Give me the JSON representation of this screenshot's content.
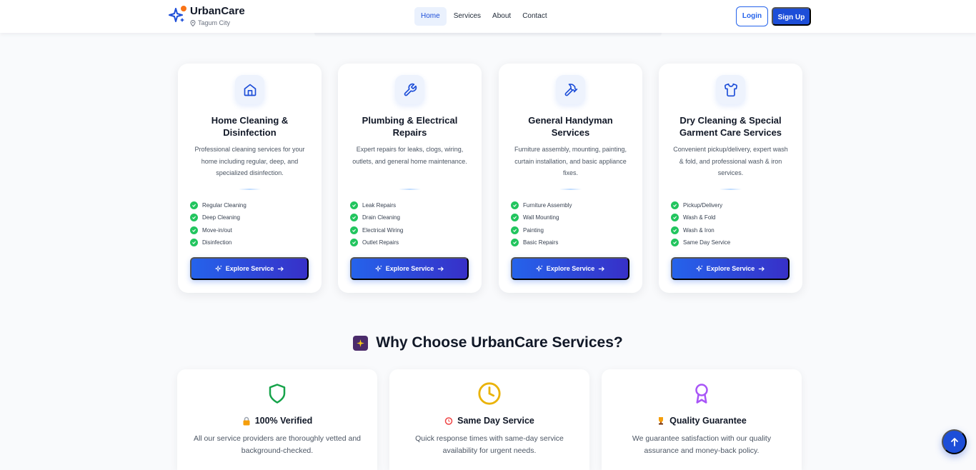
{
  "navbar": {
    "brand": "UrbanCare",
    "location": "Tagum City",
    "links": [
      "Home",
      "Services",
      "About",
      "Contact"
    ],
    "active_link": "Home",
    "login_label": "Login",
    "signup_label": "Sign Up"
  },
  "services": [
    {
      "icon": "home-icon",
      "title": "Home Cleaning & Disinfection",
      "description": "Professional cleaning services for your home including regular, deep, and specialized disinfection.",
      "features": [
        "Regular Cleaning",
        "Deep Cleaning",
        "Move-in/out",
        "Disinfection"
      ],
      "button": "Explore Service"
    },
    {
      "icon": "wrench-icon",
      "title": "Plumbing & Electrical Repairs",
      "description": "Expert repairs for leaks, clogs, wiring, outlets, and general home maintenance.",
      "features": [
        "Leak Repairs",
        "Drain Cleaning",
        "Electrical Wiring",
        "Outlet Repairs"
      ],
      "button": "Explore Service"
    },
    {
      "icon": "hammer-icon",
      "title": "General Handyman Services",
      "description": "Furniture assembly, mounting, painting, curtain installation, and basic appliance fixes.",
      "features": [
        "Furniture Assembly",
        "Wall Mounting",
        "Painting",
        "Basic Repairs"
      ],
      "button": "Explore Service"
    },
    {
      "icon": "shirt-icon",
      "title": "Dry Cleaning & Special Garment Care Services",
      "description": "Convenient pickup/delivery, expert wash & fold, and professional wash & iron services.",
      "features": [
        "Pickup/Delivery",
        "Wash & Fold",
        "Wash & Iron",
        "Same Day Service"
      ],
      "button": "Explore Service"
    }
  ],
  "why": {
    "title": "Why Choose UrbanCare Services?",
    "cards": [
      {
        "icon": "shield-icon",
        "heading": "100% Verified",
        "text": "All our service providers are thoroughly vetted and background-checked.",
        "color": "#16a34a"
      },
      {
        "icon": "clock-icon",
        "heading": "Same Day Service",
        "text": "Quick response times with same-day service availability for urgent needs.",
        "color": "#eab308"
      },
      {
        "icon": "award-icon",
        "heading": "Quality Guarantee",
        "text": "We guarantee satisfaction with our quality assurance and money-back policy.",
        "color": "#a855f7"
      }
    ]
  },
  "colors": {
    "primary": "#2563eb",
    "primary_dark": "#1d4ed8",
    "check_green": "#22c55e",
    "background": "#f9fafc"
  }
}
